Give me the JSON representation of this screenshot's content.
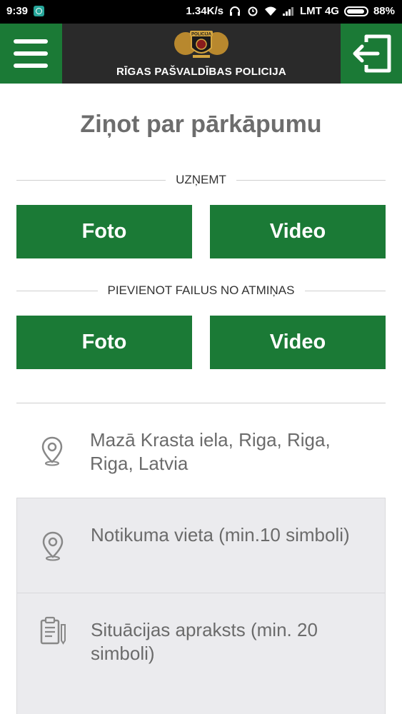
{
  "status_bar": {
    "time": "9:39",
    "speed": "1.34K/s",
    "carrier": "LMT 4G",
    "battery": "88%"
  },
  "header": {
    "org_name": "RĪGAS PAŠVALDĪBAS POLICIJA",
    "logo_text": "POLICIJA"
  },
  "page": {
    "title": "Ziņot par pārkāpumu"
  },
  "capture_section": {
    "label": "UZŅEMT",
    "photo_label": "Foto",
    "video_label": "Video"
  },
  "files_section": {
    "label": "PIEVIENOT FAILUS NO ATMIŅAS",
    "photo_label": "Foto",
    "video_label": "Video"
  },
  "location": {
    "address": "Mazā Krasta iela, Riga, Riga, Riga, Latvia"
  },
  "form": {
    "place_placeholder": "Notikuma vieta (min.10 simboli)",
    "description_placeholder": "Situācijas apraksts (min. 20 simboli)"
  },
  "colors": {
    "brand_green": "#1b7a36",
    "header_dark": "#2a2a2a"
  }
}
